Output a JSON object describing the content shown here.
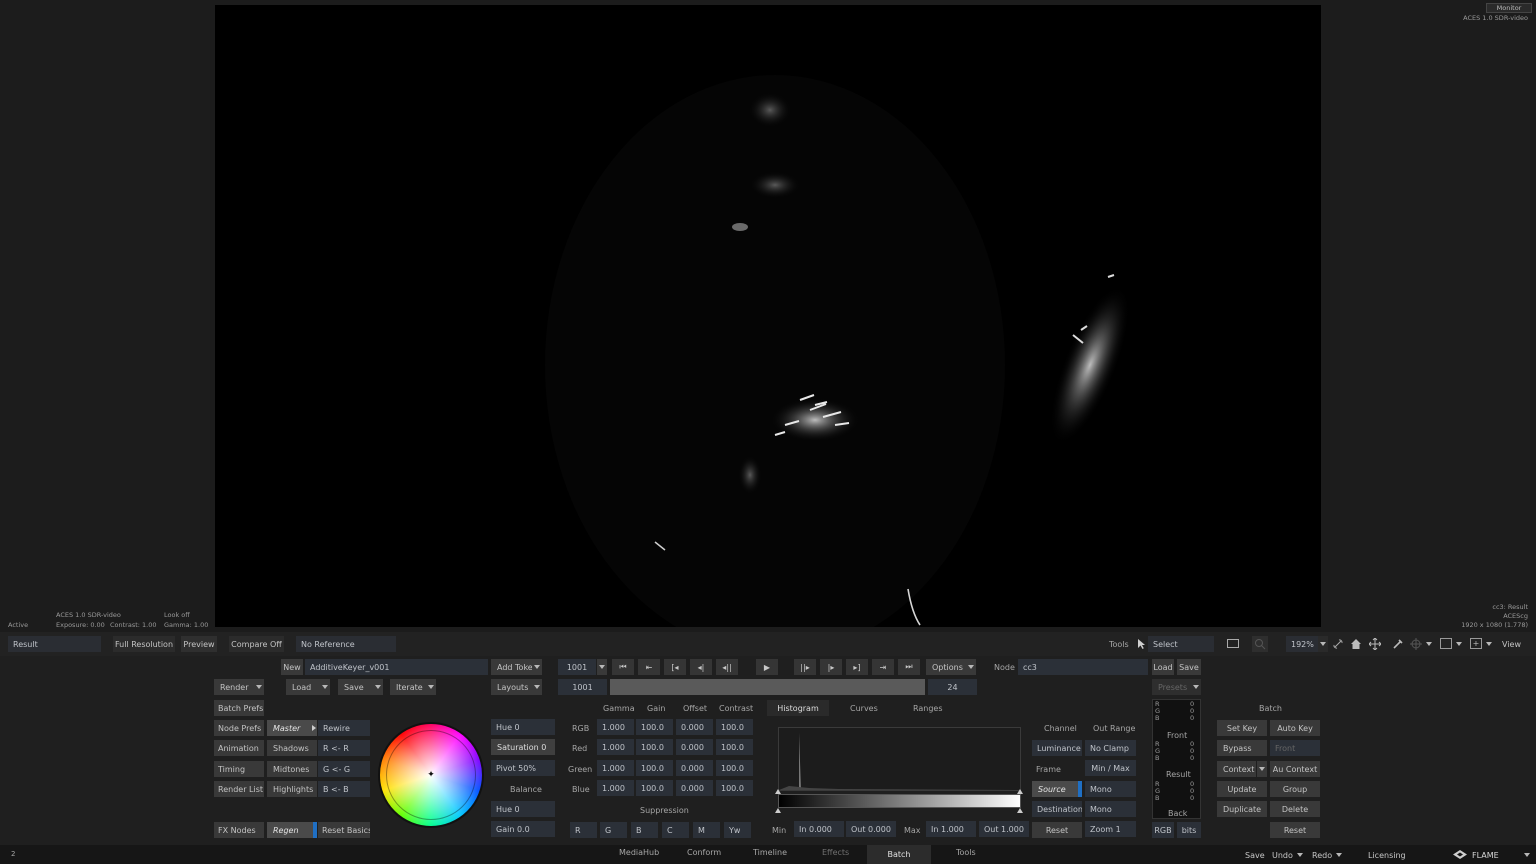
{
  "viewer": {
    "top_right_monitor": "Monitor",
    "top_right_colorspace": "ACES 1.0 SDR-video",
    "bottom_left": {
      "state": "Active",
      "colorspace": "ACES 1.0 SDR-video",
      "exposure": "Exposure: 0.00",
      "look": "Look off",
      "contrast": "Contrast: 1.00",
      "gamma": "Gamma: 1.00"
    },
    "bottom_right": {
      "node": "cc3: Result",
      "working": "ACEScg",
      "resolution": "1920 x 1080 (1.778)"
    }
  },
  "viewer_bar": {
    "view_name": "Result",
    "full_resolution": "Full Resolution",
    "preview": "Preview",
    "compare": "Compare Off",
    "reference": "No Reference",
    "tools": "Tools",
    "select": "Select",
    "zoom": "192%",
    "view": "View"
  },
  "batch_left": {
    "new": "New",
    "setup_name": "AdditiveKeyer_v001",
    "add_token": "Add Token",
    "render": "Render",
    "load": "Load",
    "save": "Save",
    "iterate": "Iterate",
    "layouts": "Layouts",
    "batch_prefs": "Batch Prefs",
    "node_prefs": "Node Prefs",
    "animation": "Animation",
    "timing": "Timing",
    "render_list": "Render List",
    "fx_nodes": "FX Nodes"
  },
  "tone_tabs": {
    "master": "Master",
    "shadows": "Shadows",
    "midtones": "Midtones",
    "highlights": "Highlights",
    "regen": "Regen"
  },
  "rewire": {
    "rewire": "Rewire",
    "r": "R <- R",
    "g": "G <- G",
    "b": "B <- B",
    "reset_basics": "Reset Basics"
  },
  "hue_sat": {
    "hue": "Hue  0",
    "saturation": "Saturation 0",
    "pivot": "Pivot 50%",
    "balance": "Balance",
    "hue2": "Hue  0",
    "gain": "Gain 0.0"
  },
  "transport": {
    "frame": "1001",
    "start": "1001",
    "end": "24",
    "options": "Options"
  },
  "corrector": {
    "headers": [
      "Gamma",
      "Gain",
      "Offset",
      "Contrast"
    ],
    "rows": [
      {
        "label": "RGB",
        "values": [
          "1.000",
          "100.0",
          "0.000",
          "100.0"
        ]
      },
      {
        "label": "Red",
        "values": [
          "1.000",
          "100.0",
          "0.000",
          "100.0"
        ]
      },
      {
        "label": "Green",
        "values": [
          "1.000",
          "100.0",
          "0.000",
          "100.0"
        ]
      },
      {
        "label": "Blue",
        "values": [
          "1.000",
          "100.0",
          "0.000",
          "100.0"
        ]
      }
    ],
    "suppression": "Suppression",
    "supp_buttons": [
      "R",
      "G",
      "B",
      "C",
      "M",
      "Yw"
    ]
  },
  "histogram": {
    "tabs": [
      "Histogram",
      "Curves",
      "Ranges"
    ],
    "min": "Min",
    "in_min": "In 0.000",
    "out_min": "Out 0.000",
    "max": "Max",
    "in_max": "In 1.000",
    "out_max": "Out 1.000"
  },
  "node": {
    "label": "Node",
    "name": "cc3",
    "load": "Load",
    "save": "Save",
    "presets": "Presets"
  },
  "channel": {
    "channel": "Channel",
    "out_range": "Out Range",
    "luminance": "Luminance",
    "no_clamp": "No Clamp",
    "frame": "Frame",
    "min_max": "Min / Max",
    "source": "Source",
    "mono1": "Mono",
    "destination": "Destination",
    "mono2": "Mono",
    "reset": "Reset",
    "zoom": "Zoom 1"
  },
  "readout": {
    "rows": [
      "R",
      "G",
      "B"
    ],
    "values": [
      "0",
      "0",
      "0"
    ],
    "front": "Front",
    "result": "Result",
    "back": "Back",
    "rgb": "RGB",
    "bits": "bits"
  },
  "batch_right": {
    "title": "Batch",
    "set_key": "Set Key",
    "auto_key": "Auto Key",
    "bypass": "Bypass",
    "front": "Front",
    "context": "Context",
    "au_context": "Au Context",
    "update": "Update",
    "group": "Group",
    "duplicate": "Duplicate",
    "delete": "Delete",
    "reset": "Reset"
  },
  "bottom_tabs": [
    "MediaHub",
    "Conform",
    "Timeline",
    "Effects",
    "Batch",
    "Tools"
  ],
  "bottom_right": {
    "save": "Save",
    "undo": "Undo",
    "redo": "Redo",
    "licensing": "Licensing",
    "app": "FLAME"
  },
  "bottom_left_num": "2",
  "colors": {
    "accent_blue": "#1f6fc4",
    "panel": "#1f1f1f",
    "field": "#2b3038"
  }
}
